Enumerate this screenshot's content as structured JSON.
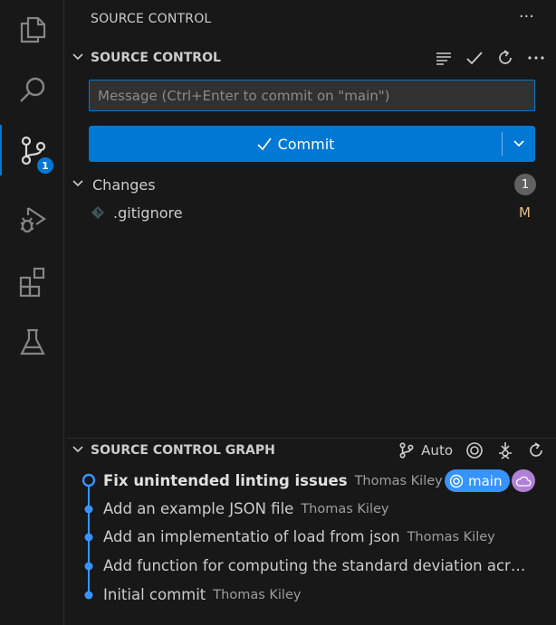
{
  "activity_bar": {
    "items": [
      {
        "name": "explorer",
        "icon": "files-icon"
      },
      {
        "name": "search",
        "icon": "search-icon"
      },
      {
        "name": "source-control",
        "icon": "source-control-icon",
        "badge": "1",
        "active": true
      },
      {
        "name": "run-debug",
        "icon": "run-debug-icon"
      },
      {
        "name": "extensions",
        "icon": "extensions-icon"
      },
      {
        "name": "testing",
        "icon": "beaker-icon"
      }
    ]
  },
  "sidebar": {
    "title": "SOURCE CONTROL",
    "more": "···"
  },
  "source_control": {
    "section_title": "SOURCE CONTROL",
    "message_placeholder": "Message (Ctrl+Enter to commit on \"main\")",
    "message_value": "",
    "commit_label": "Commit",
    "changes": {
      "label": "Changes",
      "count": "1",
      "files": [
        {
          "name": ".gitignore",
          "status": "M"
        }
      ]
    }
  },
  "graph": {
    "section_title": "SOURCE CONTROL GRAPH",
    "auto_label": "Auto",
    "commits": [
      {
        "message": "Fix unintended linting issues",
        "author": "Thomas Kiley",
        "branch": "main",
        "current": true
      },
      {
        "message": "Add an example JSON file",
        "author": "Thomas Kiley"
      },
      {
        "message": "Add an implementatio of load from json",
        "author": "Thomas Kiley"
      },
      {
        "message": "Add function for computing the standard deviation acr…",
        "author": ""
      },
      {
        "message": "Initial commit",
        "author": "Thomas Kiley"
      }
    ]
  },
  "colors": {
    "accent": "#0078d4",
    "branch_badge": "#3794ff",
    "remote_badge": "#b180d7",
    "modified": "#e2c08d"
  }
}
